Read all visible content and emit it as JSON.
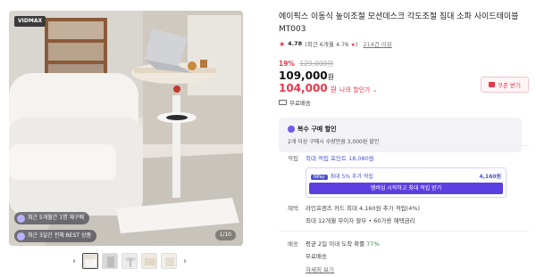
{
  "gallery": {
    "brand_logo": "VIDMAX",
    "chips": [
      {
        "text": "최근 5개월간 1명 재구매",
        "icon": "repurchase-icon"
      },
      {
        "text": "최근 3일간 전체 BEST 상품",
        "icon": "best-icon"
      }
    ],
    "counter": "1/10",
    "thumb_count": 5
  },
  "product": {
    "title": "에이픽스 이동식 높이조절 모션데스크 각도조절 침대 소파 사이드테이블 MT003",
    "rating": {
      "score": "4.78",
      "detail": "(최근 6개월 4.76",
      "detail_end": ")",
      "reviews": "214건 리뷰"
    },
    "discount_rate": "19%",
    "original_price": "129,000원",
    "price": "109,000",
    "price_unit": "원",
    "my_price": "104,000",
    "my_price_unit": "원",
    "my_price_label": "나의 할인가",
    "coupon_button": "쿠폰 받기",
    "free_shipping": "무료배송"
  },
  "multi_discount": {
    "title": "복수 구매 할인",
    "desc": "2개 이상 구매시 수량만큼 3,000원 할인"
  },
  "points": {
    "label": "적립",
    "max_text": "최대 적립 포인트 18,080원",
    "badge": "NPay",
    "extra": "최대 5% 추가 적립",
    "amount": "4,160원",
    "button": "멤버십 시작하고 최대 적립 받기"
  },
  "card": {
    "label": "혜택",
    "line1": "라인프렌즈 카드 최대 4,160원 추가 적립(4%)",
    "line2": "최대 12개월 무이자 할부 • 60가용 혜택금리"
  },
  "shipping": {
    "label": "배송",
    "line1_prefix": "평균 2일 이내 도착 확률 ",
    "line1_rate": "77%",
    "line2": "무료배송",
    "detail": "자세히 보기"
  },
  "colors": {
    "accent_red": "#e8364c",
    "accent_purple": "#5b3fe0",
    "point_blue": "#4a52c9"
  }
}
